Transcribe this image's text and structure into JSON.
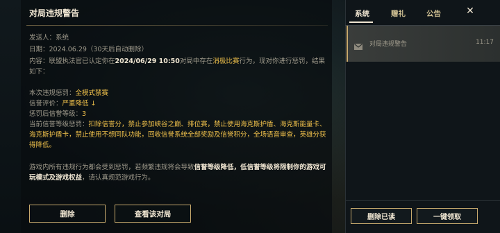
{
  "message": {
    "title": "对局违规警告",
    "sender_label": "发送人：",
    "sender": "系统",
    "date_label": "日期：",
    "date": "2024.06.29",
    "auto_delete": "（30天后自动删除）",
    "content_label": "内容：",
    "content_part1": "联盟执法官已认定你在",
    "content_time": "2024/06/29 10:50",
    "content_part2": "对局中存在",
    "content_violation": "消极比赛",
    "content_part3": "行为，现对你进行惩罚，结果如下：",
    "penalty_label": "本次违规惩罚：",
    "penalty_value": "全模式禁赛",
    "credit_label": "信誉评价：",
    "credit_value": "严重降低 ↓",
    "level_label": "惩罚后信誉等级：",
    "level_value": "3",
    "current_label": "当前信誉等级惩罚：",
    "current_value": "扣除信誉分，禁止参加峡谷之巅、排位赛，禁止使用海克斯护盾、海克斯能量卡、海克斯护盾卡，禁止使用不想同队功能，回收信誉系统全部奖励及信誉积分，全场语音审查，英雄分获得降低。",
    "footer_part1": "游戏内所有违规行为都会受到惩罚，若频繁违规将会导致",
    "footer_bold1": "信誉等级降低，低信誉等级将限制你的游戏可玩模式及游戏权益",
    "footer_part2": "，请认真规范游戏行为。",
    "delete_button": "删除",
    "view_match_button": "查看该对局"
  },
  "notifications": {
    "tabs": [
      "系统",
      "赠礼",
      "公告"
    ],
    "close_icon": "close-icon",
    "items": [
      {
        "icon": "mail-icon",
        "title": "对局违规警告",
        "time": "11:17"
      }
    ],
    "delete_read_button": "删除已读",
    "claim_all_button": "一键领取"
  },
  "colors": {
    "accent_gold": "#c8aa6e",
    "highlight": "#f0c14b",
    "text_main": "#f0e6d2",
    "text_muted": "#a09b8c"
  }
}
